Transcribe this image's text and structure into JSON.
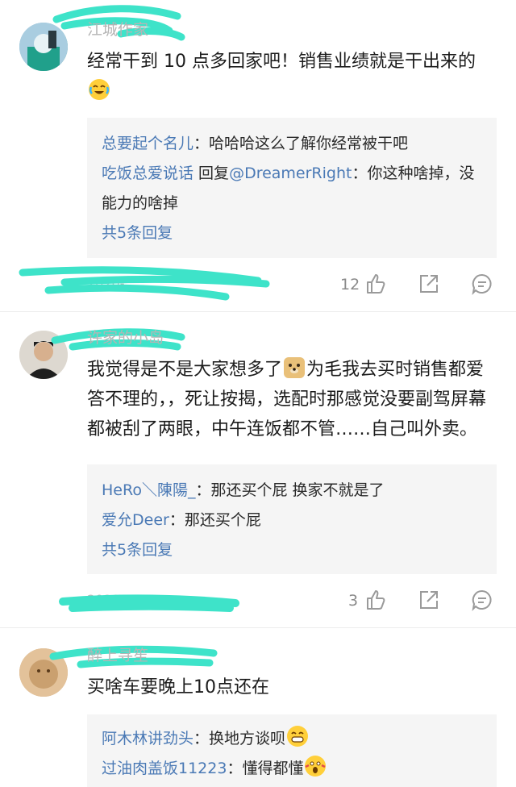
{
  "comments": [
    {
      "username": "江城作家",
      "body": "经常干到 10 点多回家吧！销售业绩就是干出来的",
      "emoji_after": "laughing-crying-emoji",
      "replies": [
        {
          "name": "总要起个名儿",
          "text": "：哈哈哈这么了解你经常被干吧"
        },
        {
          "name": "吃饭总爱说话",
          "text_pre": " 回复",
          "mention": "@DreamerRight",
          "text": "：你这种啥掉，没能力的啥掉"
        }
      ],
      "more_replies": "共5条回复",
      "date": "2020-",
      "likes": "12"
    },
    {
      "username": "许家的小岛",
      "body_part1": "我觉得是不是大家想多了",
      "emoji_mid": "doge-emoji",
      "body_part2": "为毛我去买时销售都爱答不理的，，死让按揭，选配时那感觉没要副驾屏幕都被刮了两眼，中午连饭都不管……自己叫外卖。",
      "replies": [
        {
          "name": "HeRo＼陳陽_",
          "text": "：那还买个屁 换家不就是了"
        },
        {
          "name": "爱允Deer",
          "text": "：那还买个屁"
        }
      ],
      "more_replies": "共5条回复",
      "date": "2020-",
      "likes": "3"
    },
    {
      "username": "醉上寻笙",
      "body": "买啥车要晚上10点还在",
      "replies": [
        {
          "name": "阿木林讲劲头",
          "text": "：换地方谈呗",
          "emoji": "grinning-emoji"
        },
        {
          "name": "过油肉盖饭11223",
          "text": "：懂得都懂",
          "emoji": "screaming-emoji"
        }
      ]
    }
  ],
  "colors": {
    "scribble": "#3ee3c9",
    "link": "#4a79b5",
    "reply_bg": "#f5f5f5"
  }
}
